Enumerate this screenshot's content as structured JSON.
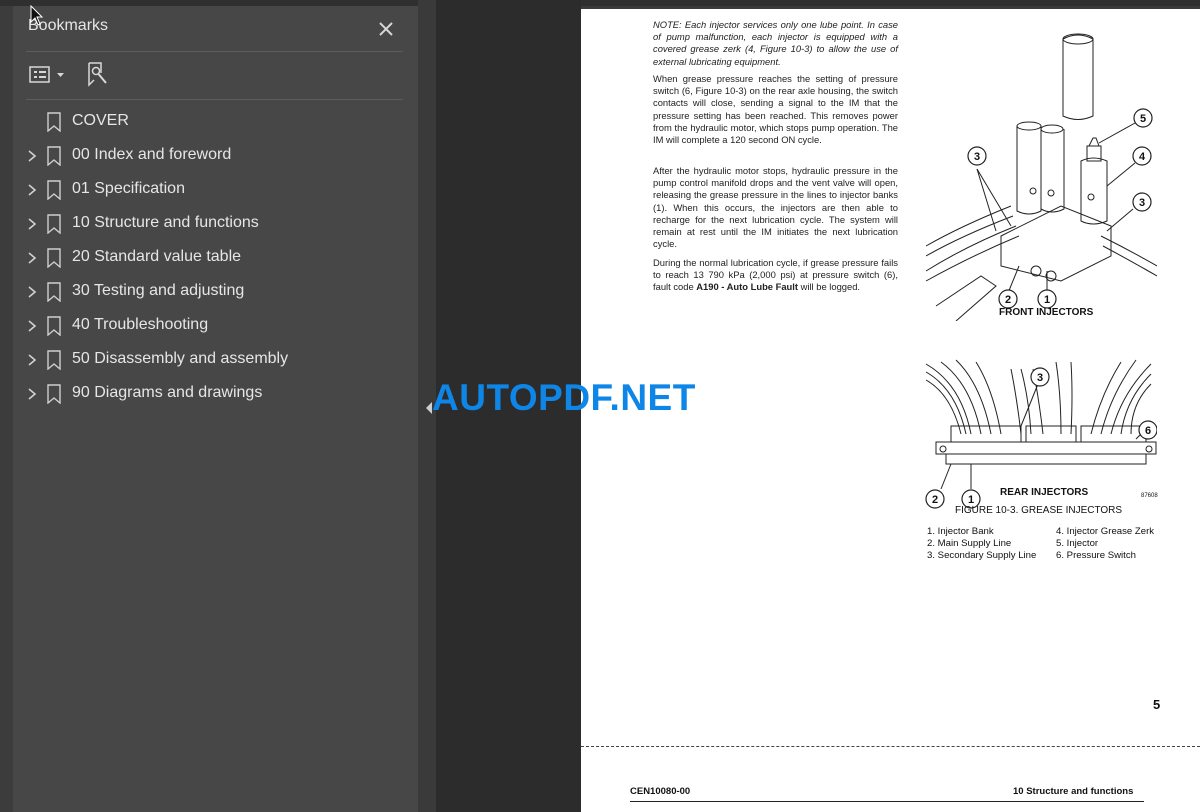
{
  "sidebar": {
    "title": "Bookmarks",
    "items": [
      {
        "label": "COVER",
        "expandable": false
      },
      {
        "label": "00 Index and foreword",
        "expandable": true
      },
      {
        "label": "01 Specification",
        "expandable": true
      },
      {
        "label": "10 Structure and functions",
        "expandable": true
      },
      {
        "label": "20 Standard value table",
        "expandable": true
      },
      {
        "label": "30 Testing and adjusting",
        "expandable": true
      },
      {
        "label": "40 Troubleshooting",
        "expandable": true
      },
      {
        "label": "50 Disassembly and assembly",
        "expandable": true
      },
      {
        "label": "90 Diagrams and drawings",
        "expandable": true
      }
    ]
  },
  "watermark": "AUTOPDF.NET",
  "document": {
    "para1": "NOTE: Each injector services only one lube point. In case of pump malfunction, each injector is equipped with a covered grease zerk (4, Figure 10-3) to allow the use of external lubricating equipment.",
    "para2": "When grease pressure reaches the setting of pressure switch (6, Figure 10-3) on the rear axle housing, the switch contacts will close, sending a signal to the IM that the pressure setting has been reached. This removes power from the hydraulic motor, which stops pump operation. The IM will complete a 120 second ON cycle.",
    "para3": "After the hydraulic motor stops, hydraulic pressure in the pump control manifold drops and the vent valve will open, releasing the grease pressure in the lines to injector banks (1). When this occurs, the injectors are then able to recharge for the next lubrication cycle. The system will remain at rest until the IM initiates the next lubrication cycle.",
    "para4_pre": "During the normal lubrication cycle, if grease pressure fails to reach 13 790 kPa (2,000 psi) at pressure switch (6), fault code ",
    "para4_code": "A190 - Auto Lube Fault",
    "para4_post": " will be logged.",
    "front_caption": "FRONT INJECTORS",
    "rear_caption": "REAR INJECTORS",
    "figure_code": "87608",
    "figure_title": "FIGURE 10-3. GREASE INJECTORS",
    "front_callouts": [
      "5",
      "3",
      "4",
      "3",
      "2",
      "1"
    ],
    "rear_callouts": [
      "3",
      "6",
      "2",
      "1"
    ],
    "legend": [
      "1. Injector Bank",
      "2. Main Supply Line",
      "3. Secondary Supply Line",
      "4. Injector Grease Zerk",
      "5. Injector",
      "6. Pressure Switch"
    ],
    "page_number": "5",
    "footer_left": "CEN10080-00",
    "footer_right": "10 Structure and functions"
  }
}
